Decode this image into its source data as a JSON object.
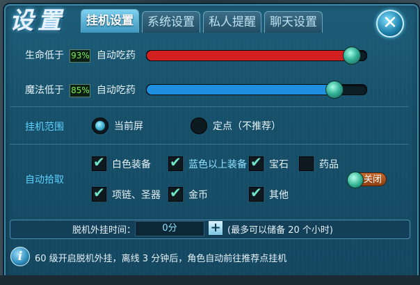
{
  "title": "设置",
  "tabs": [
    {
      "label": "挂机设置",
      "active": true
    },
    {
      "label": "系统设置",
      "active": false
    },
    {
      "label": "私人提醒",
      "active": false
    },
    {
      "label": "聊天设置",
      "active": false
    }
  ],
  "close_icon": "close-icon",
  "hp": {
    "label": "生命低于",
    "percent_text": "93%",
    "suffix": "自动吃药",
    "value": 0.93
  },
  "mp": {
    "label": "魔法低于",
    "percent_text": "85%",
    "suffix": "自动吃药",
    "value": 0.85
  },
  "range": {
    "label": "挂机范围",
    "options": [
      {
        "label": "当前屏",
        "selected": true
      },
      {
        "label": "定点（不推荐）",
        "selected": false
      }
    ]
  },
  "pickup": {
    "label": "自动拾取",
    "items": [
      {
        "label": "白色装备",
        "checked": true
      },
      {
        "label": "蓝色以上装备",
        "checked": true
      },
      {
        "label": "宝石",
        "checked": true
      },
      {
        "label": "药品",
        "checked": false
      },
      {
        "label": "项链、圣器",
        "checked": true
      },
      {
        "label": "金币",
        "checked": true
      },
      {
        "label": "其他",
        "checked": true
      }
    ],
    "toggle_label": "关闭"
  },
  "offline": {
    "label": "脱机外挂时间：",
    "value": "0分",
    "plus": "+",
    "note": "(最多可以储备 20 个小时)"
  },
  "info": {
    "icon_glyph": "i",
    "text": "60 级开启脱机外挂，离线 3 分钟后，角色自动前往推荐点挂机"
  },
  "colors": {
    "hp_fill": "#d21f1f",
    "mp_fill": "#1f8fe0",
    "accent_label": "#5dd0ff",
    "highlight_item": "#8fe3ff"
  }
}
